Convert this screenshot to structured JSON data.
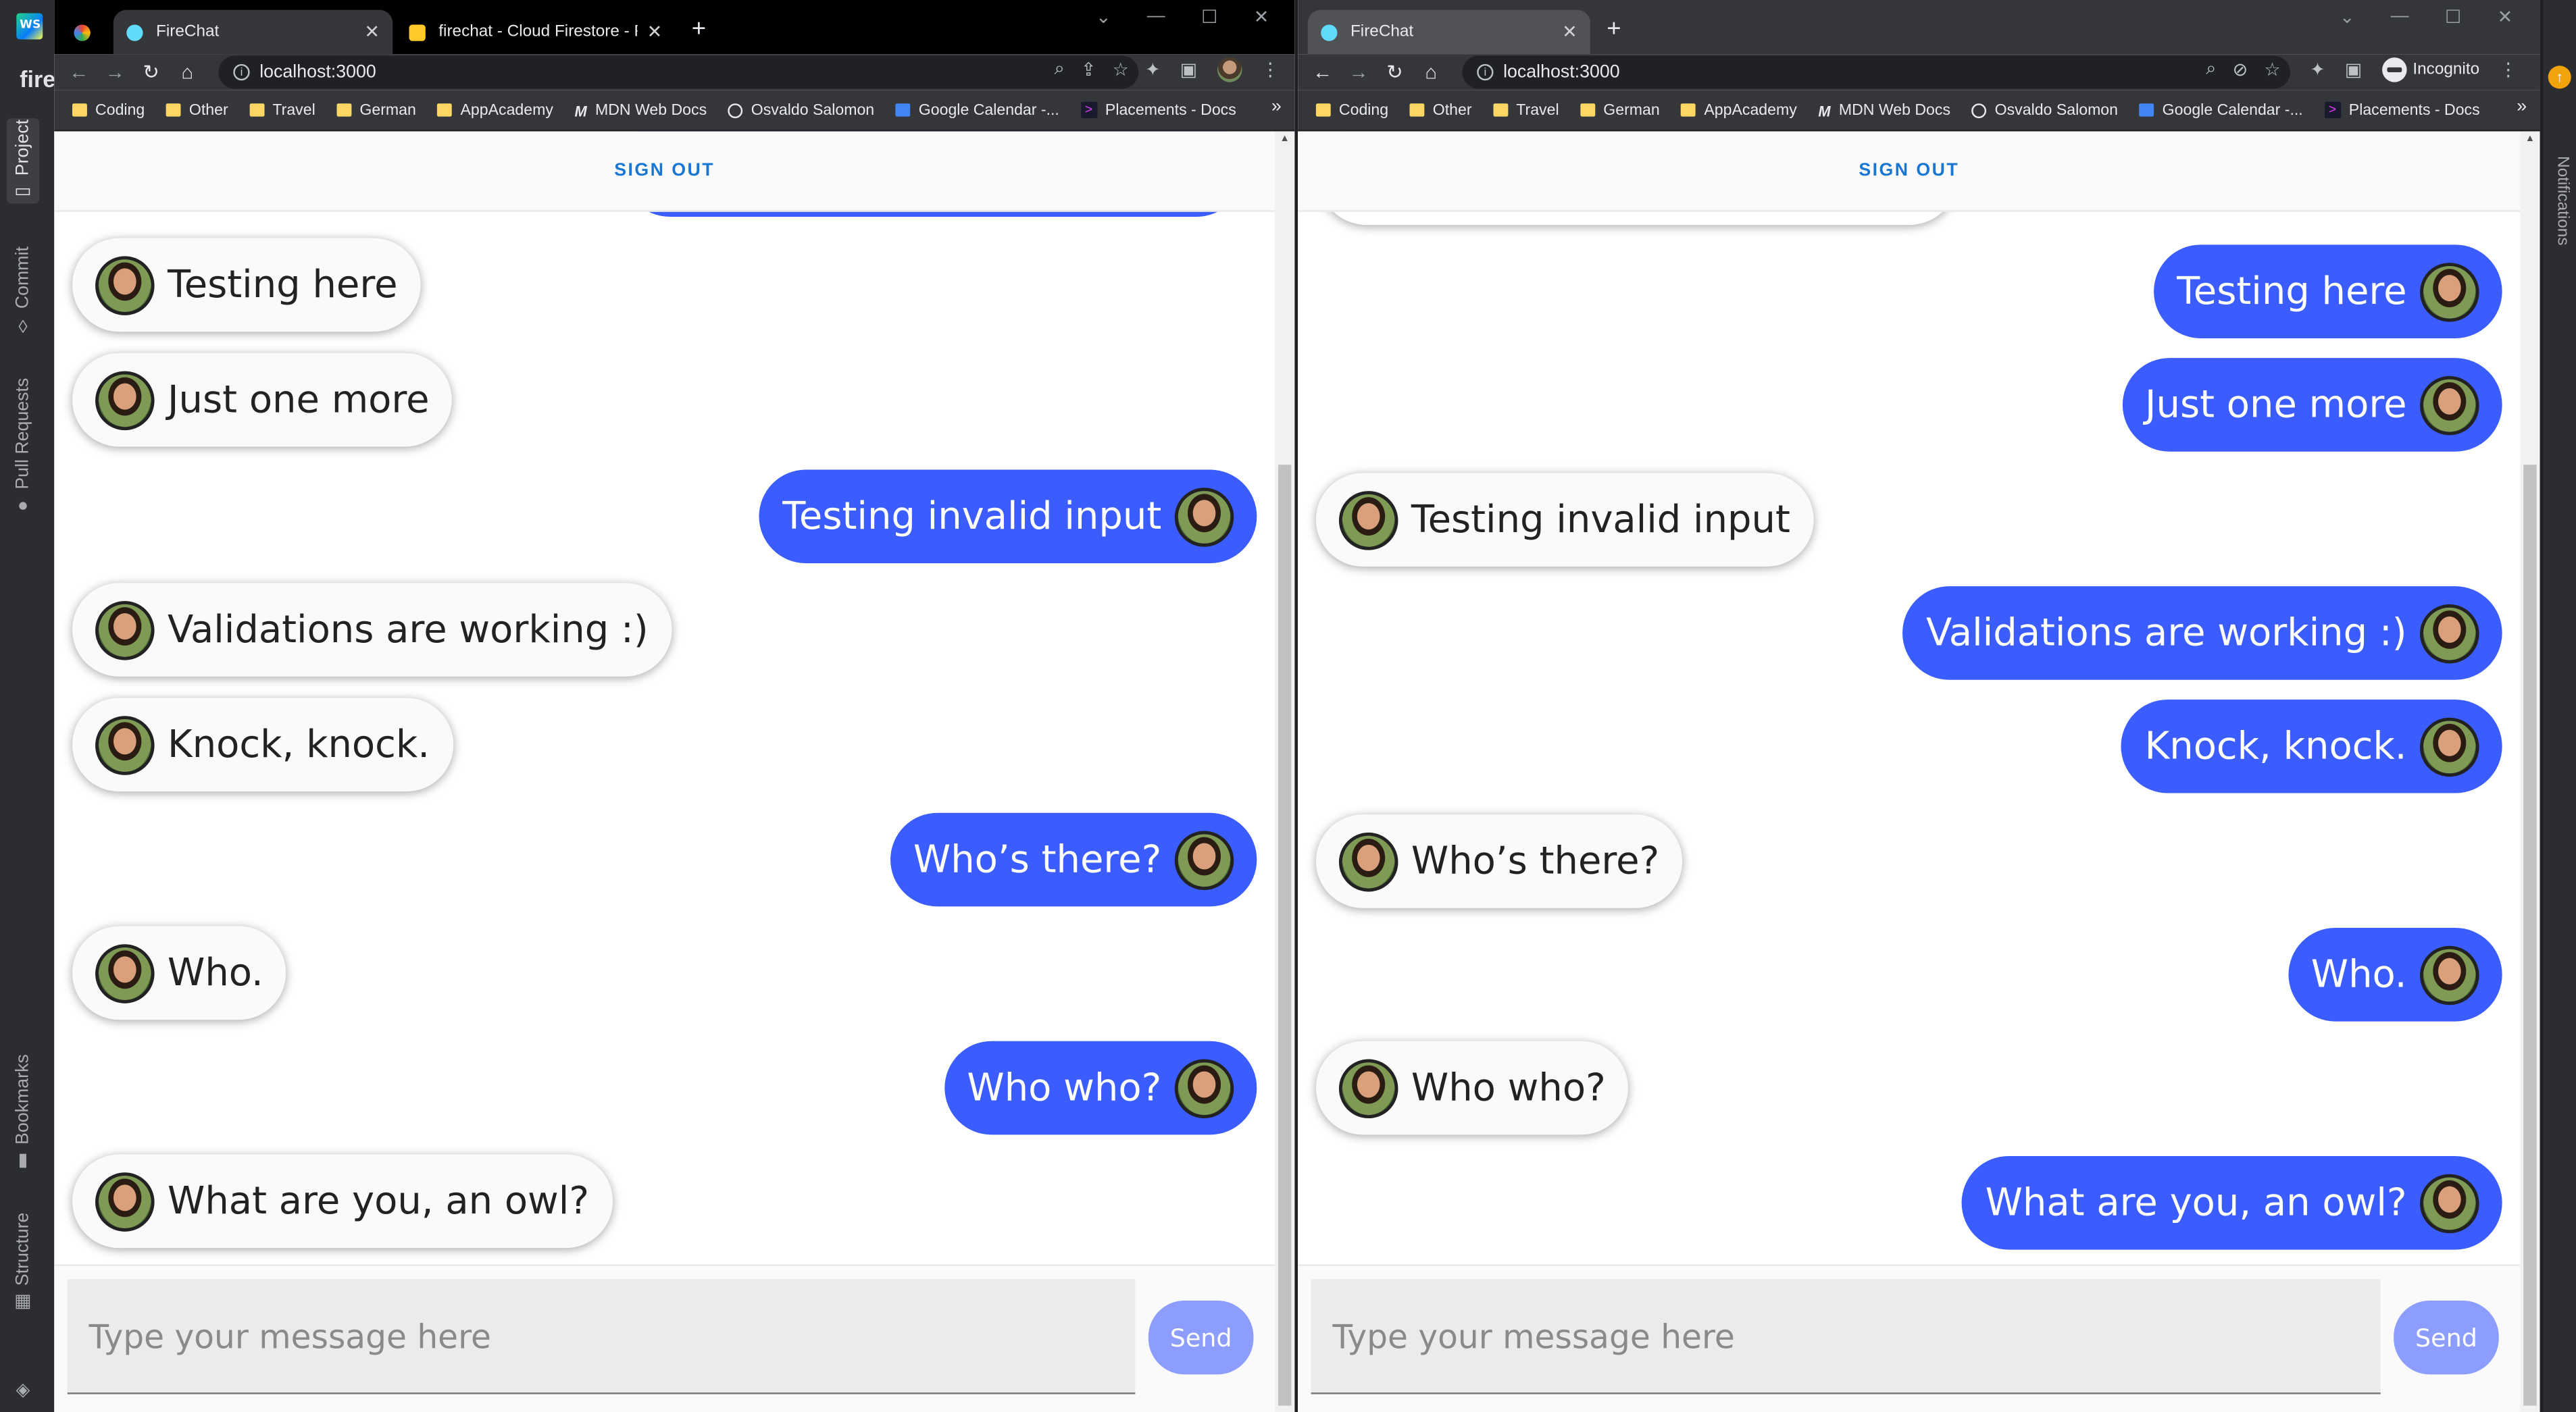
{
  "ide": {
    "project_label": "fire",
    "left_tabs": [
      "Project",
      "Commit",
      "Pull Requests",
      "Bookmarks",
      "Structure"
    ],
    "right_tabs": [
      "Notifications"
    ]
  },
  "left_browser": {
    "tabs": [
      {
        "title": "",
        "active": false
      },
      {
        "title": "FireChat",
        "active": true
      },
      {
        "title": "firechat - Cloud Firestore - Fireba",
        "active": false
      }
    ],
    "url": "localhost:3000",
    "bookmarks": [
      "Coding",
      "Other",
      "Travel",
      "German",
      "AppAcademy",
      "MDN Web Docs",
      "Osvaldo Salomon",
      "Google Calendar -...",
      "Placements - Docs"
    ],
    "chat": {
      "sign_out": "SIGN OUT",
      "messages": [
        {
          "text": "Testing here",
          "sent": false
        },
        {
          "text": "Just one more",
          "sent": false
        },
        {
          "text": "Testing invalid input",
          "sent": true
        },
        {
          "text": "Validations are working :)",
          "sent": false
        },
        {
          "text": "Knock, knock.",
          "sent": false
        },
        {
          "text": "Who’s there?",
          "sent": true
        },
        {
          "text": "Who.",
          "sent": false
        },
        {
          "text": "Who who?",
          "sent": true
        },
        {
          "text": "What are you, an owl?",
          "sent": false
        }
      ],
      "placeholder": "Type your message here",
      "send_label": "Send"
    }
  },
  "right_browser": {
    "tabs": [
      {
        "title": "FireChat",
        "active": true
      }
    ],
    "url": "localhost:3000",
    "incognito_label": "Incognito",
    "bookmarks": [
      "Coding",
      "Other",
      "Travel",
      "German",
      "AppAcademy",
      "MDN Web Docs",
      "Osvaldo Salomon",
      "Google Calendar -...",
      "Placements - Docs"
    ],
    "chat": {
      "sign_out": "SIGN OUT",
      "messages": [
        {
          "text": "Testing here",
          "sent": true
        },
        {
          "text": "Just one more",
          "sent": true
        },
        {
          "text": "Testing invalid input",
          "sent": false
        },
        {
          "text": "Validations are working :)",
          "sent": true
        },
        {
          "text": "Knock, knock.",
          "sent": true
        },
        {
          "text": "Who’s there?",
          "sent": false
        },
        {
          "text": "Who.",
          "sent": true
        },
        {
          "text": "Who who?",
          "sent": false
        },
        {
          "text": "What are you, an owl?",
          "sent": true
        }
      ],
      "placeholder": "Type your message here",
      "send_label": "Send"
    }
  },
  "colors": {
    "sent_bubble": "#3b5cff",
    "received_bubble": "#fafafa",
    "send_button": "#8c9dfe",
    "sign_out": "#1976d2"
  }
}
